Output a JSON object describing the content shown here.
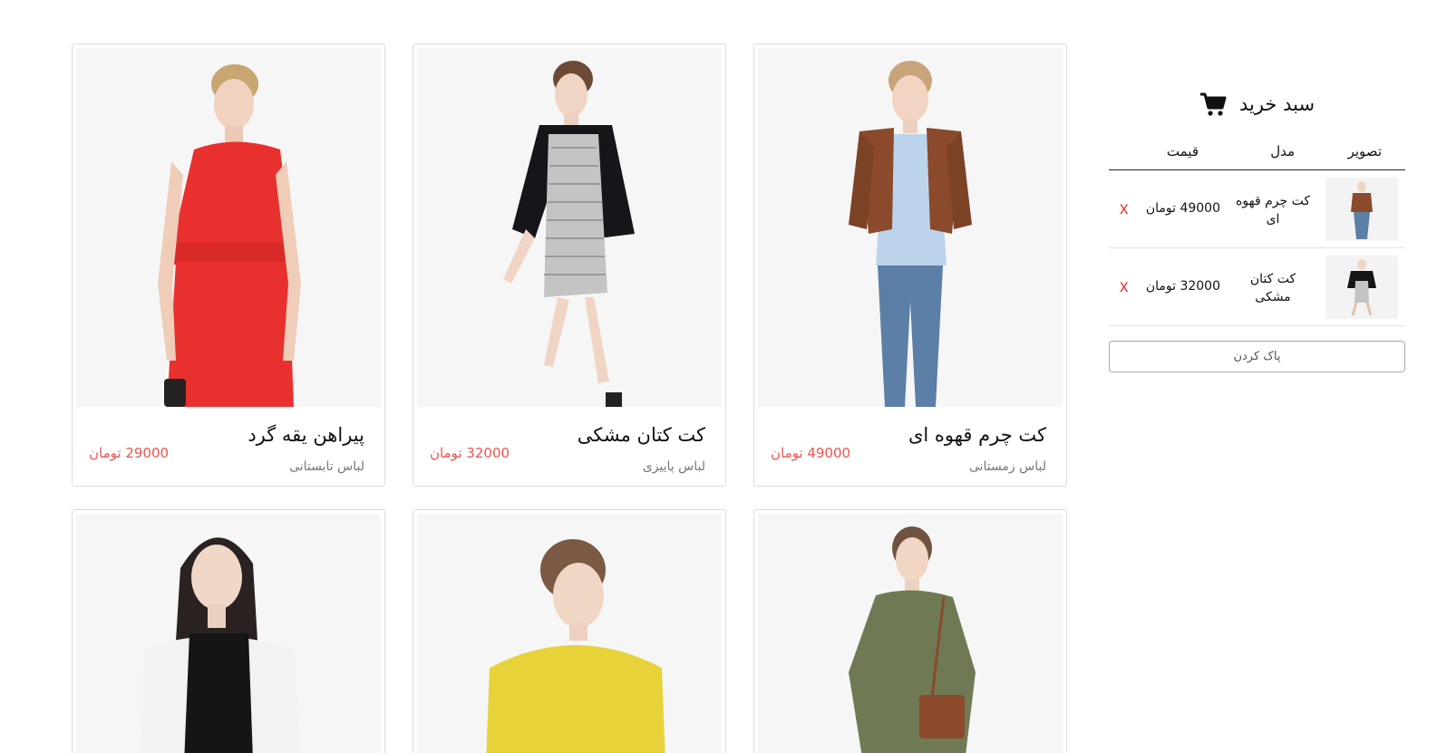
{
  "cart": {
    "title": "سبد خرید",
    "icon": "shopping-cart-icon",
    "columns": {
      "image": "تصویر",
      "model": "مدل",
      "price": "قیمت"
    },
    "items": [
      {
        "model": "کت چرم قهوه ای",
        "price": "49000 تومان",
        "remove": "x"
      },
      {
        "model": "کت کتان مشکی",
        "price": "32000 تومان",
        "remove": "x"
      }
    ],
    "clear_label": "پاک کردن"
  },
  "products": [
    {
      "title": "پیراهن یقه گرد",
      "category": "لباس تابستانی",
      "price": "29000 تومان"
    },
    {
      "title": "کت کتان مشکی",
      "category": "لباس پاییزی",
      "price": "32000 تومان"
    },
    {
      "title": "کت چرم قهوه ای",
      "category": "لباس زمستانی",
      "price": "49000 تومان"
    }
  ],
  "colors": {
    "price": "#ef5350",
    "remove": "#e53935",
    "red_dress": "#e8312e",
    "black_jacket": "#15151a",
    "brown_jacket": "#8a4a2b",
    "jeans": "#5b7fa6",
    "yellow_top": "#e8d23a",
    "olive_dress": "#6f7a55",
    "white_blazer": "#f2f2f2"
  }
}
